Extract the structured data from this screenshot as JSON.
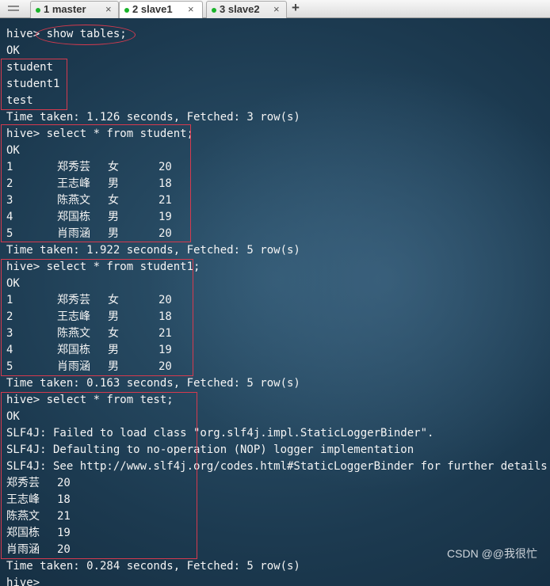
{
  "tabs": [
    {
      "num": "1",
      "name": "master",
      "close": "×"
    },
    {
      "num": "2",
      "name": "slave1",
      "close": "×",
      "active": true
    },
    {
      "num": "3",
      "name": "slave2",
      "close": "×"
    }
  ],
  "tab_add": "+",
  "colors": {
    "status_dot": "#19b32a",
    "highlight_box": "#d63a4e"
  },
  "terminal": {
    "prompt": "hive>",
    "cmd_show": "show tables;",
    "ok": "OK",
    "tables": [
      "student",
      "student1",
      "test"
    ],
    "time_show": "Time taken: 1.126 seconds, Fetched: 3 row(s)",
    "cmd_student": "hive> select * from student;",
    "student_rows": [
      [
        "1",
        "郑秀芸",
        "女",
        "20"
      ],
      [
        "2",
        "王志峰",
        "男",
        "18"
      ],
      [
        "3",
        "陈燕文",
        "女",
        "21"
      ],
      [
        "4",
        "郑国栋",
        "男",
        "19"
      ],
      [
        "5",
        "肖雨涵",
        "男",
        "20"
      ]
    ],
    "time_student": "Time taken: 1.922 seconds, Fetched: 5 row(s)",
    "cmd_student1": "hive> select * from student1;",
    "student1_rows": [
      [
        "1",
        "郑秀芸",
        "女",
        "20"
      ],
      [
        "2",
        "王志峰",
        "男",
        "18"
      ],
      [
        "3",
        "陈燕文",
        "女",
        "21"
      ],
      [
        "4",
        "郑国栋",
        "男",
        "19"
      ],
      [
        "5",
        "肖雨涵",
        "男",
        "20"
      ]
    ],
    "time_student1": "Time taken: 0.163 seconds, Fetched: 5 row(s)",
    "cmd_test": "hive> select * from test;",
    "slf4j": [
      "SLF4J: Failed to load class \"org.slf4j.impl.StaticLoggerBinder\".",
      "SLF4J: Defaulting to no-operation (NOP) logger implementation",
      "SLF4J: See http://www.slf4j.org/codes.html#StaticLoggerBinder for further details."
    ],
    "test_rows": [
      [
        "郑秀芸",
        "20"
      ],
      [
        "王志峰",
        "18"
      ],
      [
        "陈燕文",
        "21"
      ],
      [
        "郑国栋",
        "19"
      ],
      [
        "肖雨涵",
        "20"
      ]
    ],
    "time_test": "Time taken: 0.284 seconds, Fetched: 5 row(s)",
    "last_prompt": "hive>"
  },
  "watermark": "CSDN @@我很忙"
}
